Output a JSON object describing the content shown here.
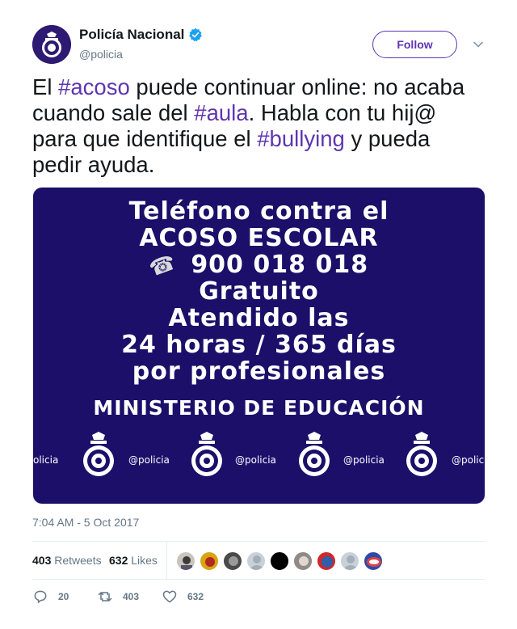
{
  "author": {
    "name": "Policía Nacional",
    "handle": "@policia"
  },
  "header": {
    "follow_label": "Follow"
  },
  "tweet": {
    "parts": [
      "El ",
      "#acoso",
      " puede continuar online: no acaba cuando sale del ",
      "#aula",
      ". Habla con tu hij@ para que identifique el ",
      "#bullying",
      " y pueda pedir ayuda."
    ],
    "timestamp": "7:04 AM - 5 Oct 2017"
  },
  "media": {
    "lines": [
      "Teléfono contra el",
      "ACOSO ESCOLAR",
      "900 018 018",
      "Gratuito",
      "Atendido las",
      "24 horas / 365 días",
      "por profesionales",
      "MINISTERIO DE EDUCACIÓN"
    ],
    "watermark": "@policia",
    "watermark_partial_left": "olicia",
    "watermark_partial_right": "@polic",
    "phone_icon": "phone-icon"
  },
  "stats": {
    "retweets_count": "403",
    "retweets_label": "Retweets",
    "likes_count": "632",
    "likes_label": "Likes"
  },
  "actions": {
    "reply_count": "20",
    "retweet_count": "403",
    "like_count": "632"
  },
  "colors": {
    "accent": "#5e35b1",
    "verified": "#1da1f2",
    "media_bg": "#1b0f6a",
    "muted": "#657786"
  }
}
